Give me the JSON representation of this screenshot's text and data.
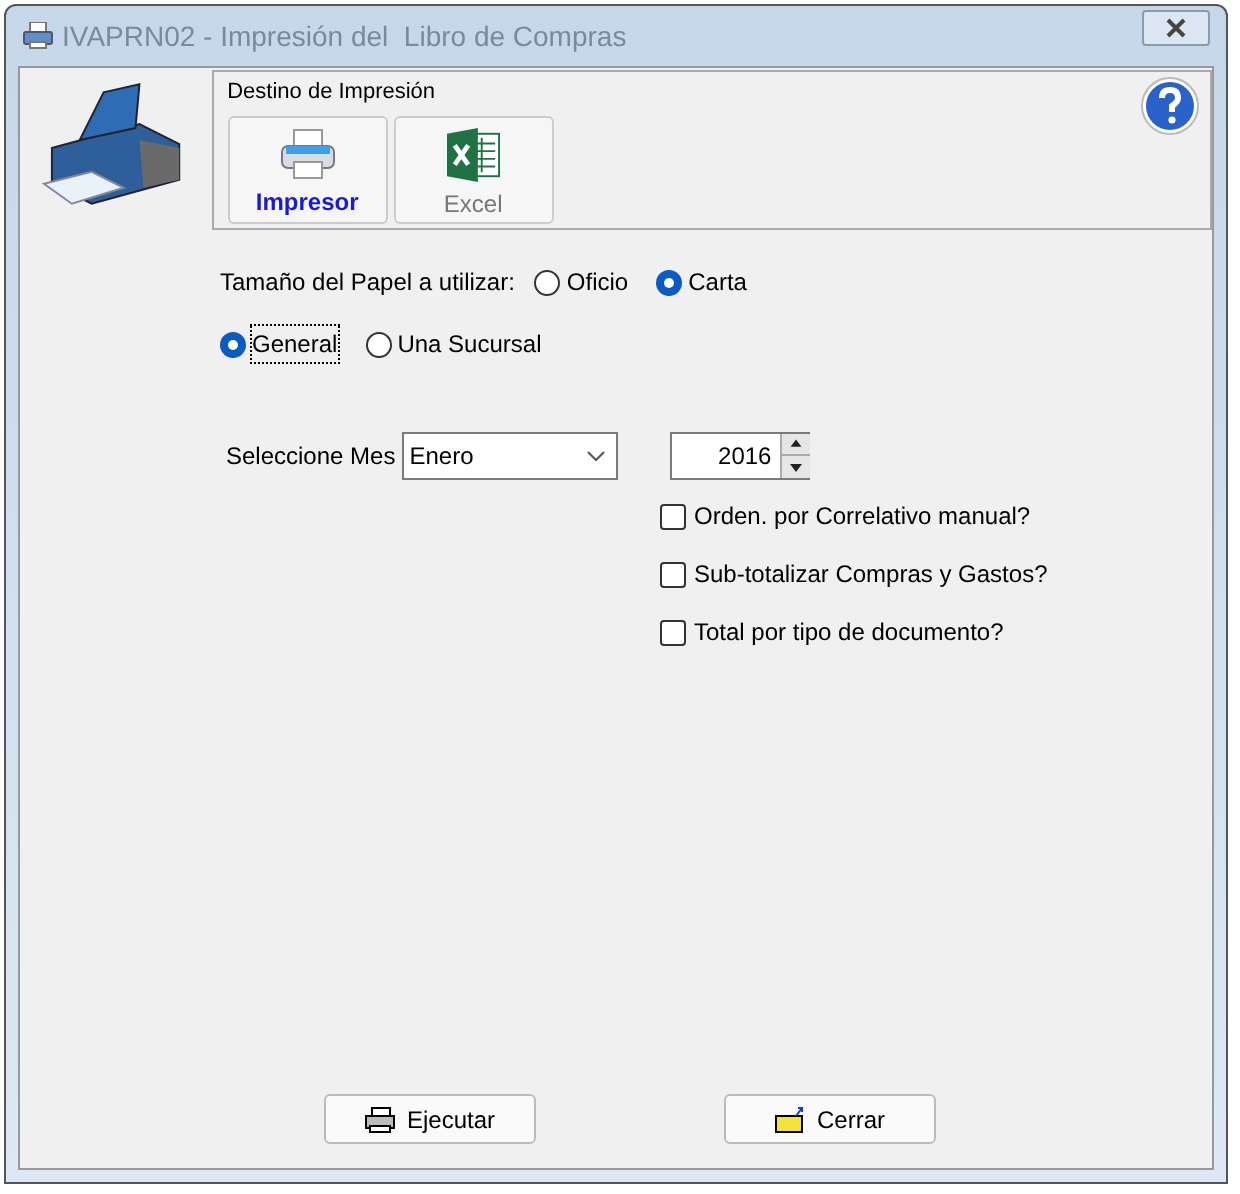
{
  "window": {
    "title": "IVAPRN02 - Impresión del  Libro de Compras"
  },
  "destination": {
    "title": "Destino de Impresión",
    "buttons": [
      {
        "kind": "printer",
        "label": "Impresor",
        "selected": true
      },
      {
        "kind": "excel",
        "label": "Excel",
        "selected": false
      }
    ]
  },
  "paper_size": {
    "label": "Tamaño del Papel a utilizar:",
    "options": [
      {
        "label": "Oficio",
        "selected": false
      },
      {
        "label": "Carta",
        "selected": true
      }
    ]
  },
  "scope": {
    "options": [
      {
        "label": "General",
        "selected": true
      },
      {
        "label": "Una Sucursal",
        "selected": false
      }
    ]
  },
  "month": {
    "label": "Seleccione Mes",
    "value": "Enero"
  },
  "year": {
    "value": "2016"
  },
  "options": [
    {
      "label": "Orden. por Correlativo manual?",
      "checked": false
    },
    {
      "label": "Sub-totalizar Compras y Gastos?",
      "checked": false
    },
    {
      "label": "Total por tipo de documento?",
      "checked": false
    }
  ],
  "actions": [
    {
      "kind": "run",
      "label": "Ejecutar"
    },
    {
      "kind": "close",
      "label": "Cerrar"
    }
  ]
}
